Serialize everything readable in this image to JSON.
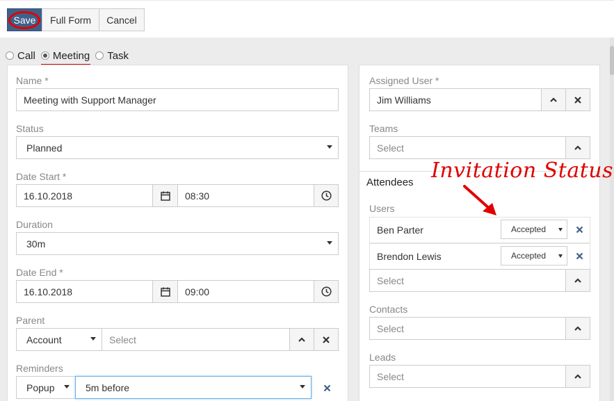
{
  "toolbar": {
    "save": "Save",
    "full_form": "Full Form",
    "cancel": "Cancel"
  },
  "activity_type": {
    "options": [
      "Call",
      "Meeting",
      "Task"
    ],
    "selected": "Meeting"
  },
  "left": {
    "name_label": "Name *",
    "name_value": "Meeting with Support Manager",
    "status_label": "Status",
    "status_value": "Planned",
    "date_start_label": "Date Start *",
    "date_start_date": "16.10.2018",
    "date_start_time": "08:30",
    "duration_label": "Duration",
    "duration_value": "30m",
    "date_end_label": "Date End *",
    "date_end_date": "16.10.2018",
    "date_end_time": "09:00",
    "parent_label": "Parent",
    "parent_type": "Account",
    "parent_placeholder": "Select",
    "reminders_label": "Reminders",
    "reminder_type": "Popup",
    "reminder_time": "5m before"
  },
  "right": {
    "assigned_user_label": "Assigned User *",
    "assigned_user_value": "Jim Williams",
    "teams_label": "Teams",
    "teams_placeholder": "Select",
    "attendees_heading": "Attendees",
    "users_label": "Users",
    "users": [
      {
        "name": "Ben Parter",
        "status": "Accepted"
      },
      {
        "name": "Brendon Lewis",
        "status": "Accepted"
      }
    ],
    "users_placeholder": "Select",
    "contacts_label": "Contacts",
    "contacts_placeholder": "Select",
    "leads_label": "Leads",
    "leads_placeholder": "Select"
  },
  "annotation": {
    "text": "Invitation Status"
  },
  "colors": {
    "primary": "#3f6089",
    "annotation_red": "#e00000",
    "background": "#ececec"
  }
}
